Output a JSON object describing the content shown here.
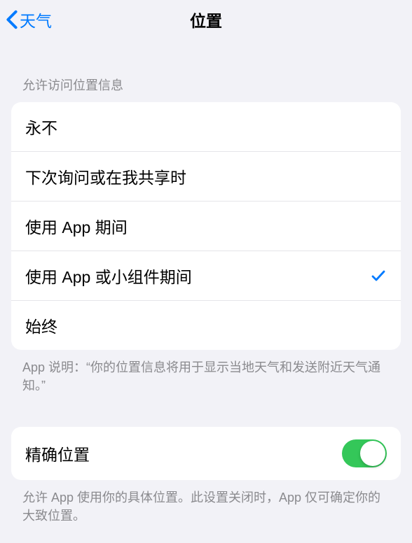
{
  "nav": {
    "back_label": "天气",
    "title": "位置"
  },
  "access_section": {
    "header": "允许访问位置信息",
    "options": [
      {
        "label": "永不",
        "selected": false
      },
      {
        "label": "下次询问或在我共享时",
        "selected": false
      },
      {
        "label": "使用 App 期间",
        "selected": false
      },
      {
        "label": "使用 App 或小组件期间",
        "selected": true
      },
      {
        "label": "始终",
        "selected": false
      }
    ],
    "footer": "App 说明：“你的位置信息将用于显示当地天气和发送附近天气通知。”"
  },
  "precise_section": {
    "label": "精确位置",
    "enabled": true,
    "footer": "允许 App 使用你的具体位置。此设置关闭时，App 仅可确定你的大致位置。"
  }
}
